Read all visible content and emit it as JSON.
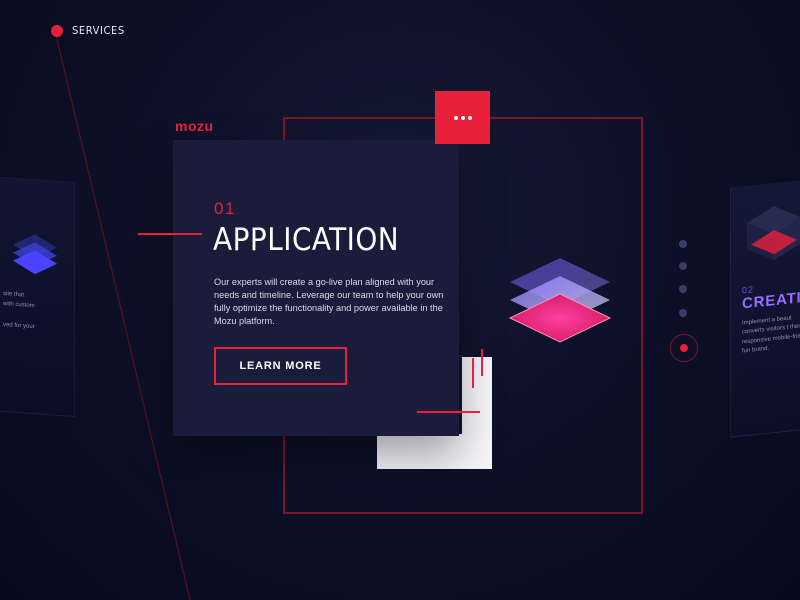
{
  "nav": {
    "label": "SERVICES"
  },
  "brand": {
    "logo": "mozu"
  },
  "main_card": {
    "number": "01",
    "title": "APPLICATION",
    "body": "Our experts will create a go-live plan aligned with your needs and timeline. Leverage our team to help your own fully optimize the functionality and power available in the Mozu platform.",
    "button_label": "LEARN MORE"
  },
  "left_card": {
    "lines": [
      "site that",
      "with custom",
      "",
      "ved for your"
    ]
  },
  "right_card": {
    "number": "02",
    "title": "CREATIV",
    "body": "Implement a beaut converts visitors t themes, responsive mobile-friendly fun brand."
  },
  "pager": {
    "count": 5,
    "active_index": 4
  },
  "colors": {
    "accent": "#e8203a",
    "background": "#0d1028",
    "card": "#1a1c3c",
    "purple": "#9a6cff"
  },
  "icons": {
    "menu": "more-dots-icon",
    "layers": "layers-icon"
  }
}
